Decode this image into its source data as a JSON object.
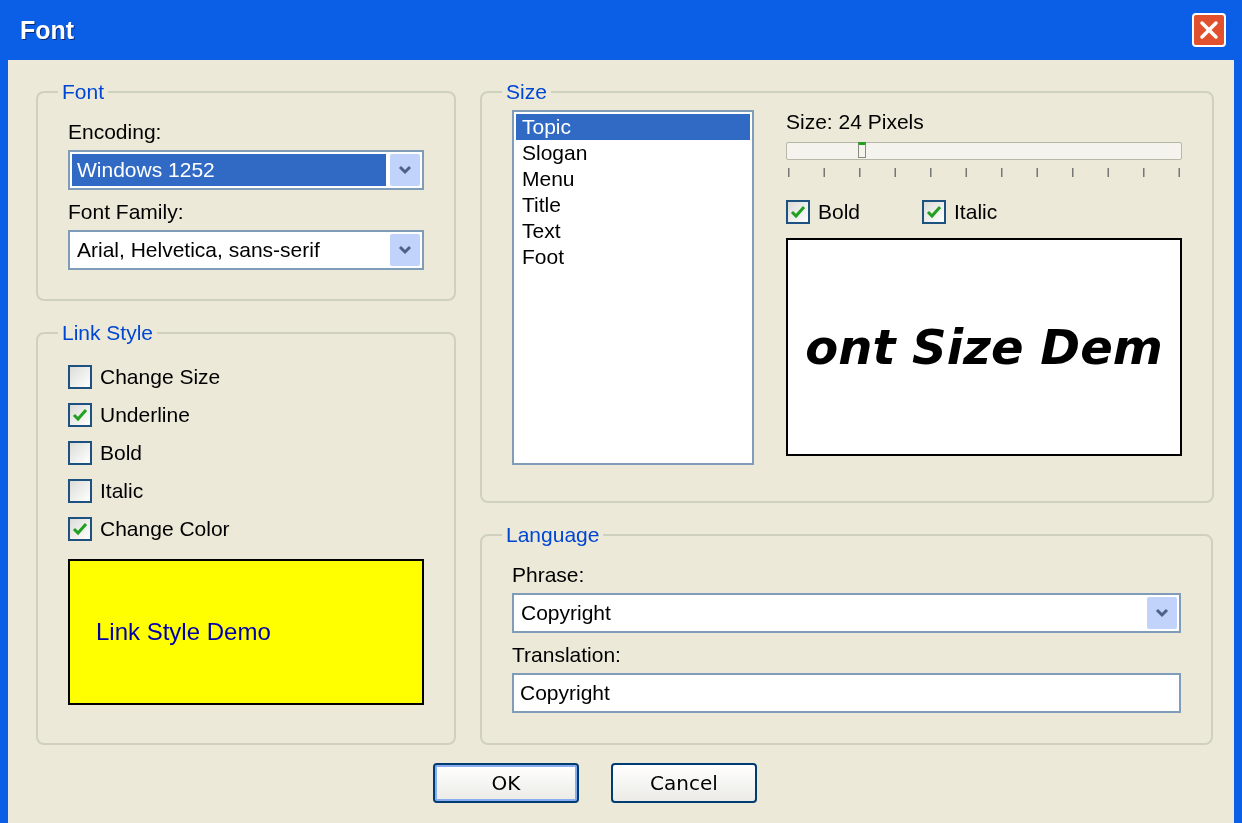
{
  "window": {
    "title": "Font"
  },
  "font_group": {
    "title": "Font",
    "encoding": {
      "label": "Encoding:",
      "value": "Windows 1252",
      "highlighted": true
    },
    "family": {
      "label": "Font Family:",
      "value": "Arial, Helvetica, sans-serif",
      "highlighted": false
    }
  },
  "link_style": {
    "title": "Link Style",
    "options": [
      {
        "label": "Change Size",
        "checked": false
      },
      {
        "label": "Underline",
        "checked": true
      },
      {
        "label": "Bold",
        "checked": false
      },
      {
        "label": "Italic",
        "checked": false
      },
      {
        "label": "Change Color",
        "checked": true
      }
    ],
    "demo": "Link Style Demo"
  },
  "size_group": {
    "title": "Size",
    "items": [
      {
        "label": "Topic",
        "selected": true
      },
      {
        "label": "Slogan",
        "selected": false
      },
      {
        "label": "Menu",
        "selected": false
      },
      {
        "label": "Title",
        "selected": false
      },
      {
        "label": "Text",
        "selected": false
      },
      {
        "label": "Foot",
        "selected": false
      }
    ],
    "size_label": "Size: 24 Pixels",
    "slider": {
      "level": 0.19
    },
    "bold": {
      "label": "Bold",
      "checked": true
    },
    "italic": {
      "label": "Italic",
      "checked": true
    },
    "preview": "ont Size Dem"
  },
  "language": {
    "title": "Language",
    "phrase": {
      "label": "Phrase:",
      "value": "Copyright"
    },
    "translation": {
      "label": "Translation:",
      "value": "Copyright"
    }
  },
  "buttons": [
    {
      "label": "OK",
      "default": true
    },
    {
      "label": "Cancel",
      "default": false
    }
  ]
}
